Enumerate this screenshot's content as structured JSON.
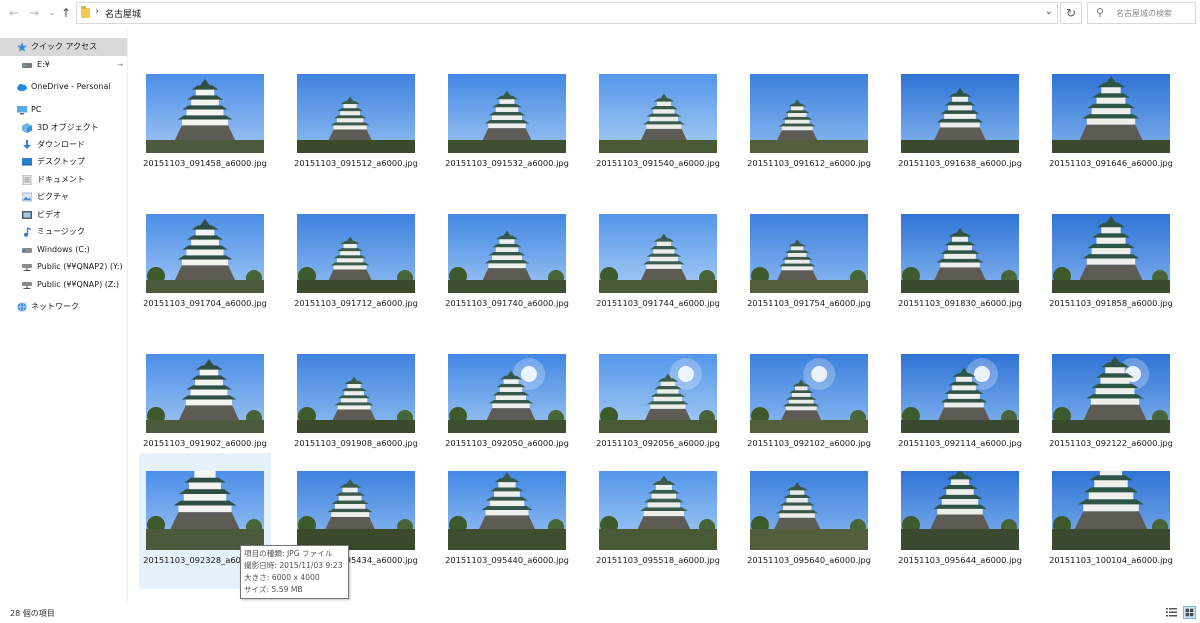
{
  "address": {
    "path": "名古屋城",
    "search_placeholder": "名古屋城の検索"
  },
  "sidebar": {
    "items": [
      {
        "label": "クイック アクセス",
        "icon": "star-icon",
        "selected": true
      },
      {
        "label": "E:¥",
        "icon": "drive-icon",
        "pinned": true
      },
      {
        "label": "OneDrive - Personal",
        "icon": "cloud-icon"
      },
      {
        "label": "PC",
        "icon": "pc-icon"
      },
      {
        "label": "3D オブジェクト",
        "icon": "cube-icon"
      },
      {
        "label": "ダウンロード",
        "icon": "download-icon"
      },
      {
        "label": "デスクトップ",
        "icon": "desktop-icon"
      },
      {
        "label": "ドキュメント",
        "icon": "document-icon"
      },
      {
        "label": "ピクチャ",
        "icon": "pictures-icon"
      },
      {
        "label": "ビデオ",
        "icon": "video-icon"
      },
      {
        "label": "ミュージック",
        "icon": "music-icon"
      },
      {
        "label": "Windows (C:)",
        "icon": "windows-drive-icon"
      },
      {
        "label": "Public (¥¥QNAP2) (Y:)",
        "icon": "network-drive-icon"
      },
      {
        "label": "Public (¥¥QNAP) (Z:)",
        "icon": "network-drive-icon"
      },
      {
        "label": "ネットワーク",
        "icon": "network-icon"
      }
    ]
  },
  "files": [
    {
      "name": "20151103_091458_a6000.jpg"
    },
    {
      "name": "20151103_091512_a6000.jpg"
    },
    {
      "name": "20151103_091532_a6000.jpg"
    },
    {
      "name": "20151103_091540_a6000.jpg"
    },
    {
      "name": "20151103_091612_a6000.jpg"
    },
    {
      "name": "20151103_091638_a6000.jpg"
    },
    {
      "name": "20151103_091646_a6000.jpg"
    },
    {
      "name": "20151103_091704_a6000.jpg"
    },
    {
      "name": "20151103_091712_a6000.jpg"
    },
    {
      "name": "20151103_091740_a6000.jpg"
    },
    {
      "name": "20151103_091744_a6000.jpg"
    },
    {
      "name": "20151103_091754_a6000.jpg"
    },
    {
      "name": "20151103_091830_a6000.jpg"
    },
    {
      "name": "20151103_091858_a6000.jpg"
    },
    {
      "name": "20151103_091902_a6000.jpg"
    },
    {
      "name": "20151103_091908_a6000.jpg"
    },
    {
      "name": "20151103_092050_a6000.jpg"
    },
    {
      "name": "20151103_092056_a6000.jpg"
    },
    {
      "name": "20151103_092102_a6000.jpg"
    },
    {
      "name": "20151103_092114_a6000.jpg"
    },
    {
      "name": "20151103_092122_a6000.jpg"
    },
    {
      "name": "20151103_092328_a6000.jpg",
      "hovered": true
    },
    {
      "name": "20151103_095434_a6000.jpg"
    },
    {
      "name": "20151103_095440_a6000.jpg"
    },
    {
      "name": "20151103_095518_a6000.jpg"
    },
    {
      "name": "20151103_095640_a6000.jpg"
    },
    {
      "name": "20151103_095644_a6000.jpg"
    },
    {
      "name": "20151103_100104_a6000.jpg"
    }
  ],
  "tooltip": {
    "type": "項目の種類: JPG ファイル",
    "date": "撮影日時: 2015/11/03 9:23",
    "size_dim": "大きさ: 6000 x 4000",
    "filesize": "サイズ: 5.59 MB"
  },
  "status": {
    "count": "28 個の項目"
  },
  "colors": {
    "selected_bg": "#d9d9d9",
    "hover_bg": "#e5f1fb",
    "accent": "#0078d7"
  }
}
